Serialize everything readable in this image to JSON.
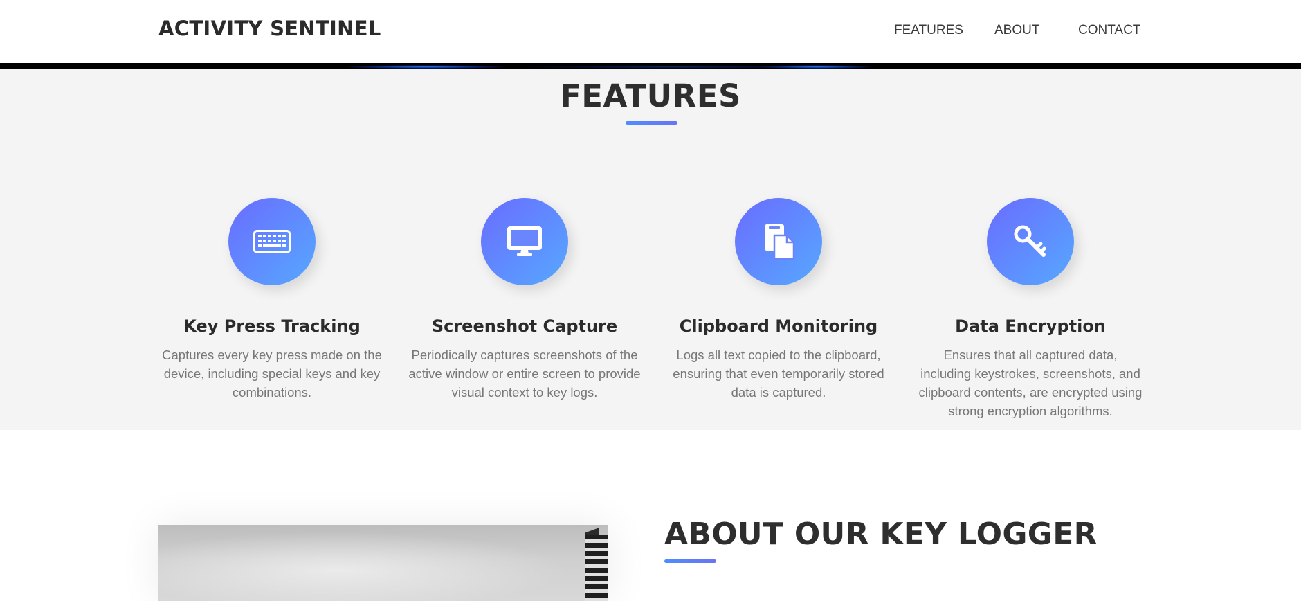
{
  "header": {
    "brand": "ACTIVITY SENTINEL",
    "nav": [
      {
        "label": "FEATURES"
      },
      {
        "label": "ABOUT"
      },
      {
        "label": "CONTACT"
      }
    ]
  },
  "features": {
    "title": "FEATURES",
    "items": [
      {
        "icon": "keyboard-icon",
        "title": "Key Press Tracking",
        "description": "Captures every key press made on the device, including special keys and key combinations."
      },
      {
        "icon": "desktop-icon",
        "title": "Screenshot Capture",
        "description": "Periodically captures screenshots of the active window or entire screen to provide visual context to key logs."
      },
      {
        "icon": "clipboard-icon",
        "title": "Clipboard Monitoring",
        "description": "Logs all text copied to the clipboard, ensuring that even temporarily stored data is captured."
      },
      {
        "icon": "key-icon",
        "title": "Data Encryption",
        "description": "Ensures that all captured data, including keystrokes, screenshots, and clipboard contents, are encrypted using strong encryption algorithms."
      }
    ]
  },
  "about": {
    "title": "ABOUT OUR KEY LOGGER"
  },
  "colors": {
    "accent_start": "#6a6cff",
    "accent_end": "#56a8ff",
    "section_bg": "#f4f4f4",
    "text_dark": "#2e2e2e",
    "text_muted": "#777777"
  }
}
